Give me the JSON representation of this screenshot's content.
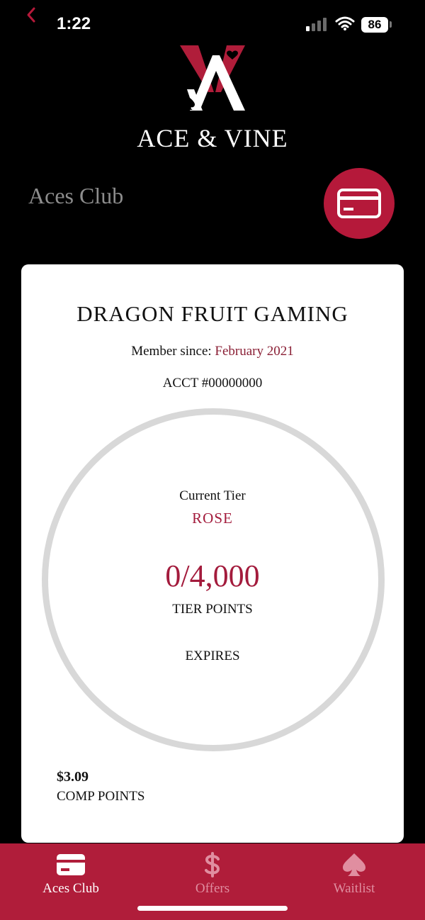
{
  "status_bar": {
    "time": "1:22",
    "battery": "86",
    "icons": [
      "back-chevron-icon",
      "signal-icon",
      "wifi-icon",
      "battery-icon"
    ]
  },
  "brand": {
    "name": "ACE & VINE"
  },
  "header": {
    "title": "Aces Club",
    "card_button_icon": "card-icon"
  },
  "member": {
    "name": "DRAGON FRUIT GAMING",
    "since_label": "Member since: ",
    "since_value": "February 2021",
    "account": "ACCT #00000000",
    "tier_label": "Current Tier",
    "tier_name": "ROSE",
    "tier_points": "0/4,000",
    "tier_progress": 0,
    "tier_points_label": "TIER POINTS",
    "expires_label": "EXPIRES",
    "comp_value": "$3.09",
    "comp_label": "COMP POINTS"
  },
  "tabs": [
    {
      "label": "Aces Club",
      "icon": "card-icon",
      "active": true
    },
    {
      "label": "Offers",
      "icon": "dollar-icon",
      "active": false
    },
    {
      "label": "Waitlist",
      "icon": "spade-icon",
      "active": false
    }
  ],
  "colors": {
    "accent": "#b01d3a",
    "accent_text": "#a31b3c",
    "background": "#000000",
    "card": "#ffffff",
    "ring": "#d8d8d8"
  }
}
